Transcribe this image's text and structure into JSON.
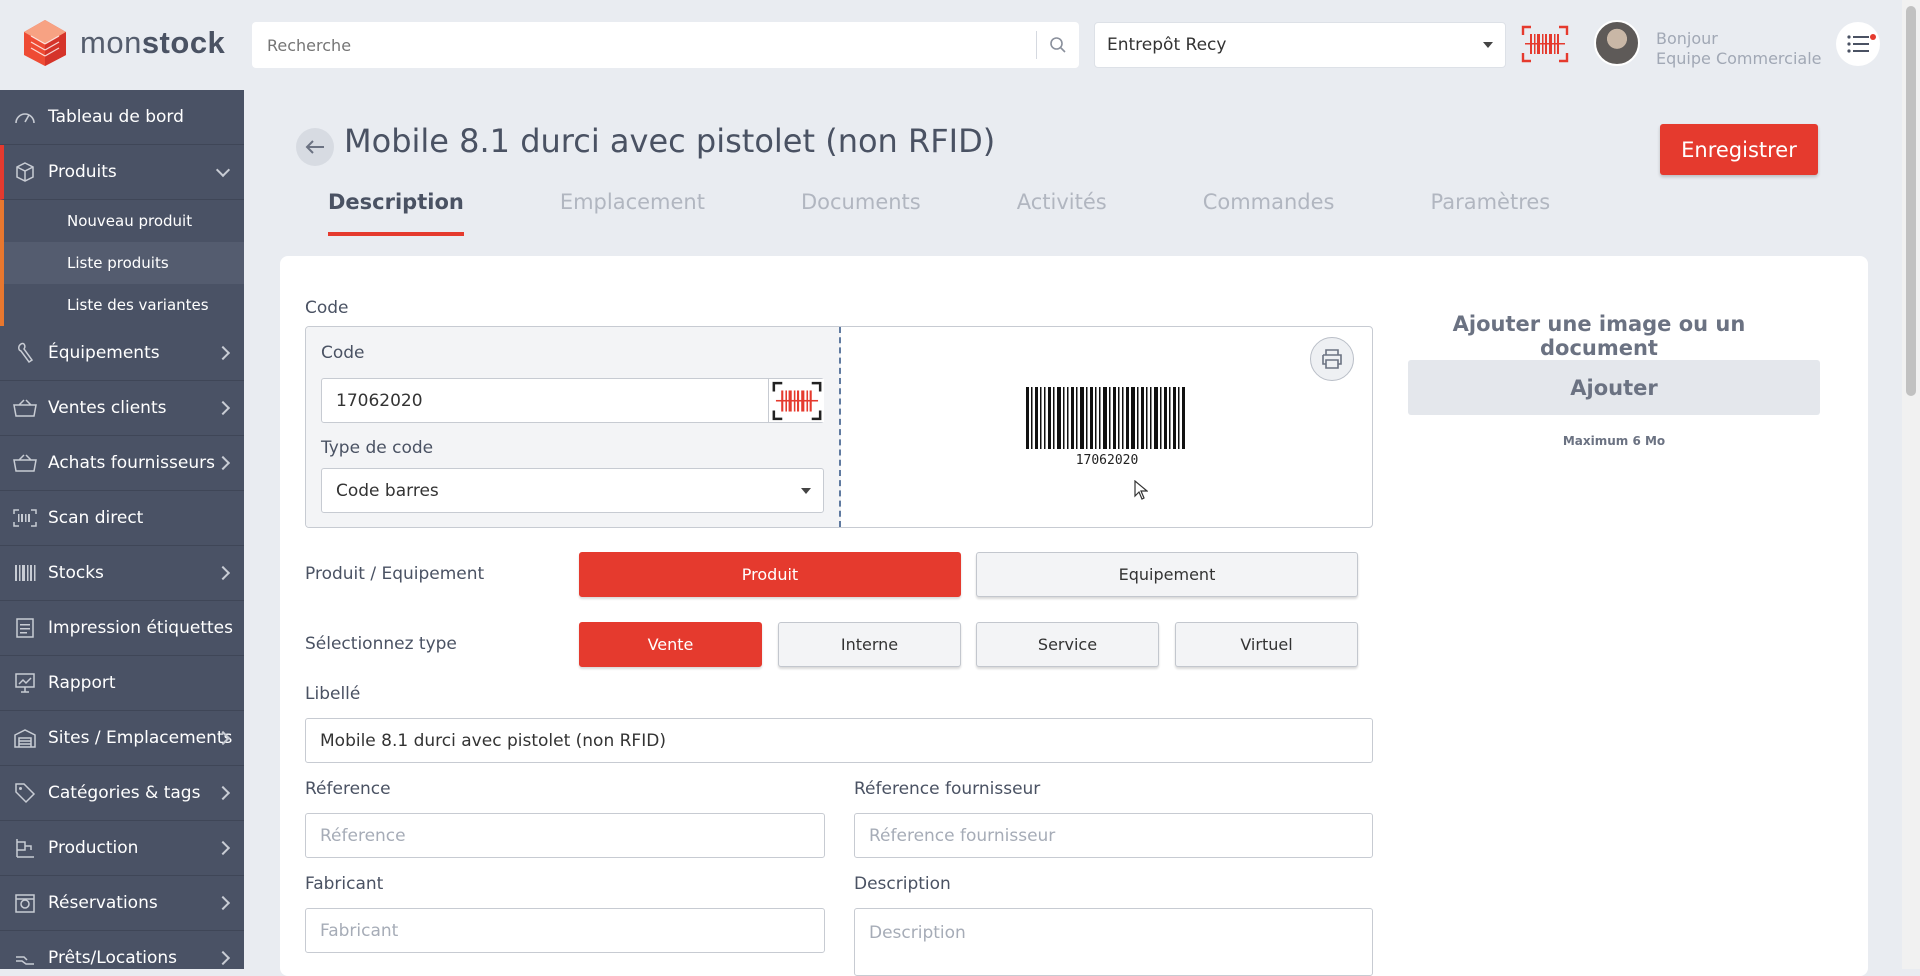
{
  "logo": {
    "brand_light": "mon",
    "brand_bold": "stock"
  },
  "search": {
    "placeholder": "Recherche"
  },
  "warehouse": {
    "selected": "Entrepôt Recy"
  },
  "user": {
    "greeting": "Bonjour",
    "name": "Equipe Commerciale"
  },
  "sidebar": {
    "items": [
      {
        "label": "Tableau de bord",
        "icon": "dashboard-icon"
      },
      {
        "label": "Produits",
        "icon": "box-icon"
      },
      {
        "label": "Équipements",
        "icon": "wrench-icon"
      },
      {
        "label": "Ventes clients",
        "icon": "cart-icon"
      },
      {
        "label": "Achats fournisseurs",
        "icon": "cart-icon"
      },
      {
        "label": "Scan direct",
        "icon": "scanner-icon"
      },
      {
        "label": "Stocks",
        "icon": "barcode-icon"
      },
      {
        "label": "Impression étiquettes",
        "icon": "label-icon"
      },
      {
        "label": "Rapport",
        "icon": "report-icon"
      },
      {
        "label": "Sites / Emplacements",
        "icon": "warehouse-icon"
      },
      {
        "label": "Catégories & tags",
        "icon": "tag-icon"
      },
      {
        "label": "Production",
        "icon": "production-icon"
      },
      {
        "label": "Réservations",
        "icon": "reservation-icon"
      },
      {
        "label": "Prêts/Locations",
        "icon": "loan-icon"
      }
    ],
    "sub_items": [
      "Nouveau produit",
      "Liste produits",
      "Liste des variantes"
    ]
  },
  "page": {
    "title": "Mobile 8.1 durci avec pistolet (non RFID)",
    "save_label": "Enregistrer",
    "tabs": [
      "Description",
      "Emplacement",
      "Documents",
      "Activités",
      "Commandes",
      "Paramètres"
    ]
  },
  "form": {
    "code_section_label": "Code",
    "code_label": "Code",
    "code_value": "17062020",
    "code_type_label": "Type de code",
    "code_type_value": "Code barres",
    "barcode_text": "17062020",
    "product_equipment_label": "Produit / Equipement",
    "product_btn": "Produit",
    "equipment_btn": "Equipement",
    "select_type_label": "Sélectionnez type",
    "type_buttons": [
      "Vente",
      "Interne",
      "Service",
      "Virtuel"
    ],
    "libelle_label": "Libellé",
    "libelle_value": "Mobile 8.1 durci avec pistolet (non RFID)",
    "reference_label": "Réference",
    "reference_placeholder": "Réference",
    "supplier_ref_label": "Réference fournisseur",
    "supplier_ref_placeholder": "Réference fournisseur",
    "manufacturer_label": "Fabricant",
    "manufacturer_placeholder": "Fabricant",
    "description_label": "Description",
    "description_placeholder": "Description"
  },
  "attachments": {
    "title": "Ajouter une image ou un document",
    "add_label": "Ajouter",
    "max_size": "Maximum 6 Mo"
  },
  "colors": {
    "accent": "#e53a2e",
    "sidebar": "#4a5265",
    "background": "#e9ecf1"
  }
}
